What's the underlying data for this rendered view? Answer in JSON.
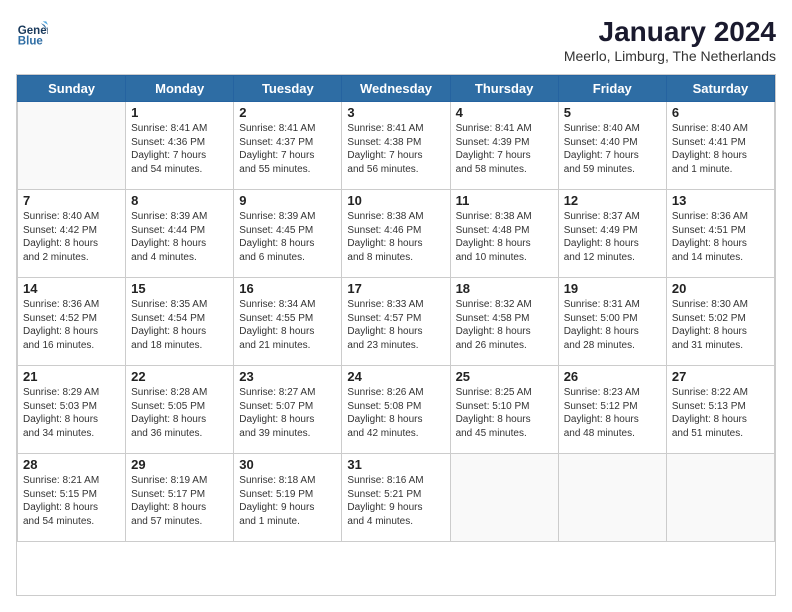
{
  "header": {
    "logo_line1": "General",
    "logo_line2": "Blue",
    "title": "January 2024",
    "subtitle": "Meerlo, Limburg, The Netherlands"
  },
  "weekdays": [
    "Sunday",
    "Monday",
    "Tuesday",
    "Wednesday",
    "Thursday",
    "Friday",
    "Saturday"
  ],
  "weeks": [
    [
      {
        "day": "",
        "info": ""
      },
      {
        "day": "1",
        "info": "Sunrise: 8:41 AM\nSunset: 4:36 PM\nDaylight: 7 hours\nand 54 minutes."
      },
      {
        "day": "2",
        "info": "Sunrise: 8:41 AM\nSunset: 4:37 PM\nDaylight: 7 hours\nand 55 minutes."
      },
      {
        "day": "3",
        "info": "Sunrise: 8:41 AM\nSunset: 4:38 PM\nDaylight: 7 hours\nand 56 minutes."
      },
      {
        "day": "4",
        "info": "Sunrise: 8:41 AM\nSunset: 4:39 PM\nDaylight: 7 hours\nand 58 minutes."
      },
      {
        "day": "5",
        "info": "Sunrise: 8:40 AM\nSunset: 4:40 PM\nDaylight: 7 hours\nand 59 minutes."
      },
      {
        "day": "6",
        "info": "Sunrise: 8:40 AM\nSunset: 4:41 PM\nDaylight: 8 hours\nand 1 minute."
      }
    ],
    [
      {
        "day": "7",
        "info": "Sunrise: 8:40 AM\nSunset: 4:42 PM\nDaylight: 8 hours\nand 2 minutes."
      },
      {
        "day": "8",
        "info": "Sunrise: 8:39 AM\nSunset: 4:44 PM\nDaylight: 8 hours\nand 4 minutes."
      },
      {
        "day": "9",
        "info": "Sunrise: 8:39 AM\nSunset: 4:45 PM\nDaylight: 8 hours\nand 6 minutes."
      },
      {
        "day": "10",
        "info": "Sunrise: 8:38 AM\nSunset: 4:46 PM\nDaylight: 8 hours\nand 8 minutes."
      },
      {
        "day": "11",
        "info": "Sunrise: 8:38 AM\nSunset: 4:48 PM\nDaylight: 8 hours\nand 10 minutes."
      },
      {
        "day": "12",
        "info": "Sunrise: 8:37 AM\nSunset: 4:49 PM\nDaylight: 8 hours\nand 12 minutes."
      },
      {
        "day": "13",
        "info": "Sunrise: 8:36 AM\nSunset: 4:51 PM\nDaylight: 8 hours\nand 14 minutes."
      }
    ],
    [
      {
        "day": "14",
        "info": "Sunrise: 8:36 AM\nSunset: 4:52 PM\nDaylight: 8 hours\nand 16 minutes."
      },
      {
        "day": "15",
        "info": "Sunrise: 8:35 AM\nSunset: 4:54 PM\nDaylight: 8 hours\nand 18 minutes."
      },
      {
        "day": "16",
        "info": "Sunrise: 8:34 AM\nSunset: 4:55 PM\nDaylight: 8 hours\nand 21 minutes."
      },
      {
        "day": "17",
        "info": "Sunrise: 8:33 AM\nSunset: 4:57 PM\nDaylight: 8 hours\nand 23 minutes."
      },
      {
        "day": "18",
        "info": "Sunrise: 8:32 AM\nSunset: 4:58 PM\nDaylight: 8 hours\nand 26 minutes."
      },
      {
        "day": "19",
        "info": "Sunrise: 8:31 AM\nSunset: 5:00 PM\nDaylight: 8 hours\nand 28 minutes."
      },
      {
        "day": "20",
        "info": "Sunrise: 8:30 AM\nSunset: 5:02 PM\nDaylight: 8 hours\nand 31 minutes."
      }
    ],
    [
      {
        "day": "21",
        "info": "Sunrise: 8:29 AM\nSunset: 5:03 PM\nDaylight: 8 hours\nand 34 minutes."
      },
      {
        "day": "22",
        "info": "Sunrise: 8:28 AM\nSunset: 5:05 PM\nDaylight: 8 hours\nand 36 minutes."
      },
      {
        "day": "23",
        "info": "Sunrise: 8:27 AM\nSunset: 5:07 PM\nDaylight: 8 hours\nand 39 minutes."
      },
      {
        "day": "24",
        "info": "Sunrise: 8:26 AM\nSunset: 5:08 PM\nDaylight: 8 hours\nand 42 minutes."
      },
      {
        "day": "25",
        "info": "Sunrise: 8:25 AM\nSunset: 5:10 PM\nDaylight: 8 hours\nand 45 minutes."
      },
      {
        "day": "26",
        "info": "Sunrise: 8:23 AM\nSunset: 5:12 PM\nDaylight: 8 hours\nand 48 minutes."
      },
      {
        "day": "27",
        "info": "Sunrise: 8:22 AM\nSunset: 5:13 PM\nDaylight: 8 hours\nand 51 minutes."
      }
    ],
    [
      {
        "day": "28",
        "info": "Sunrise: 8:21 AM\nSunset: 5:15 PM\nDaylight: 8 hours\nand 54 minutes."
      },
      {
        "day": "29",
        "info": "Sunrise: 8:19 AM\nSunset: 5:17 PM\nDaylight: 8 hours\nand 57 minutes."
      },
      {
        "day": "30",
        "info": "Sunrise: 8:18 AM\nSunset: 5:19 PM\nDaylight: 9 hours\nand 1 minute."
      },
      {
        "day": "31",
        "info": "Sunrise: 8:16 AM\nSunset: 5:21 PM\nDaylight: 9 hours\nand 4 minutes."
      },
      {
        "day": "",
        "info": ""
      },
      {
        "day": "",
        "info": ""
      },
      {
        "day": "",
        "info": ""
      }
    ]
  ]
}
